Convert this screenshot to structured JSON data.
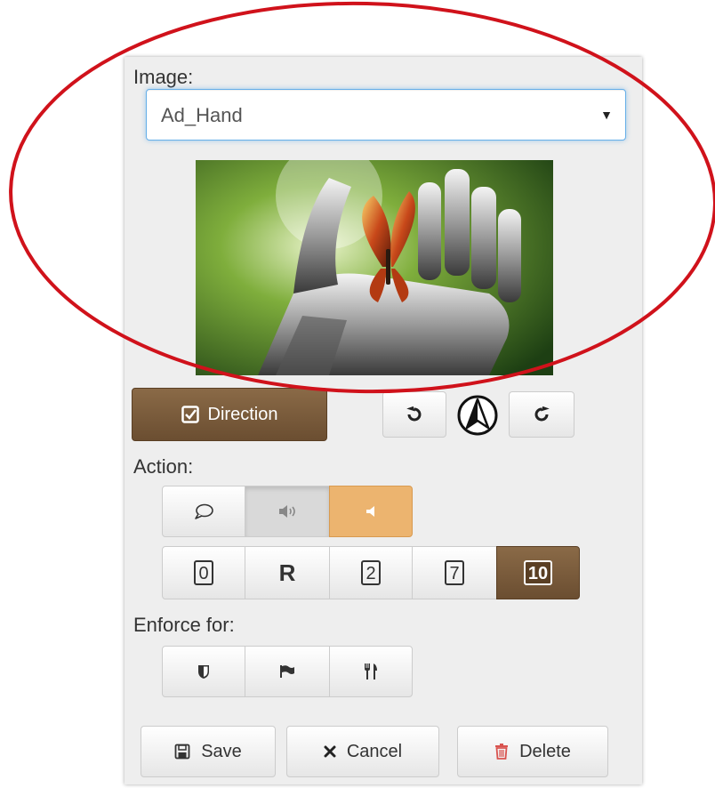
{
  "image_section": {
    "label": "Image:",
    "selected": "Ad_Hand"
  },
  "direction_button": {
    "label": "Direction",
    "icon": "checkbox-icon"
  },
  "rotate": {
    "left_icon": "rotate-left-icon",
    "compass_icon": "compass-icon",
    "right_icon": "rotate-right-icon"
  },
  "action_section": {
    "label": "Action:",
    "mode_buttons": [
      "speech-bubble-icon",
      "volume-icon",
      "volume-off-icon"
    ],
    "count_buttons": [
      "0",
      "R",
      "2",
      "7",
      "10"
    ]
  },
  "enforce_section": {
    "label": "Enforce for:",
    "buttons": [
      "shield-icon",
      "flag-icon",
      "cutlery-icon"
    ]
  },
  "footer": {
    "save_label": "Save",
    "cancel_label": "Cancel",
    "delete_label": "Delete"
  },
  "colors": {
    "accent_brown": "#6b4e31",
    "accent_orange": "#ecb46f",
    "delete_red": "#d9534f",
    "annotation_red": "#d0121b"
  }
}
